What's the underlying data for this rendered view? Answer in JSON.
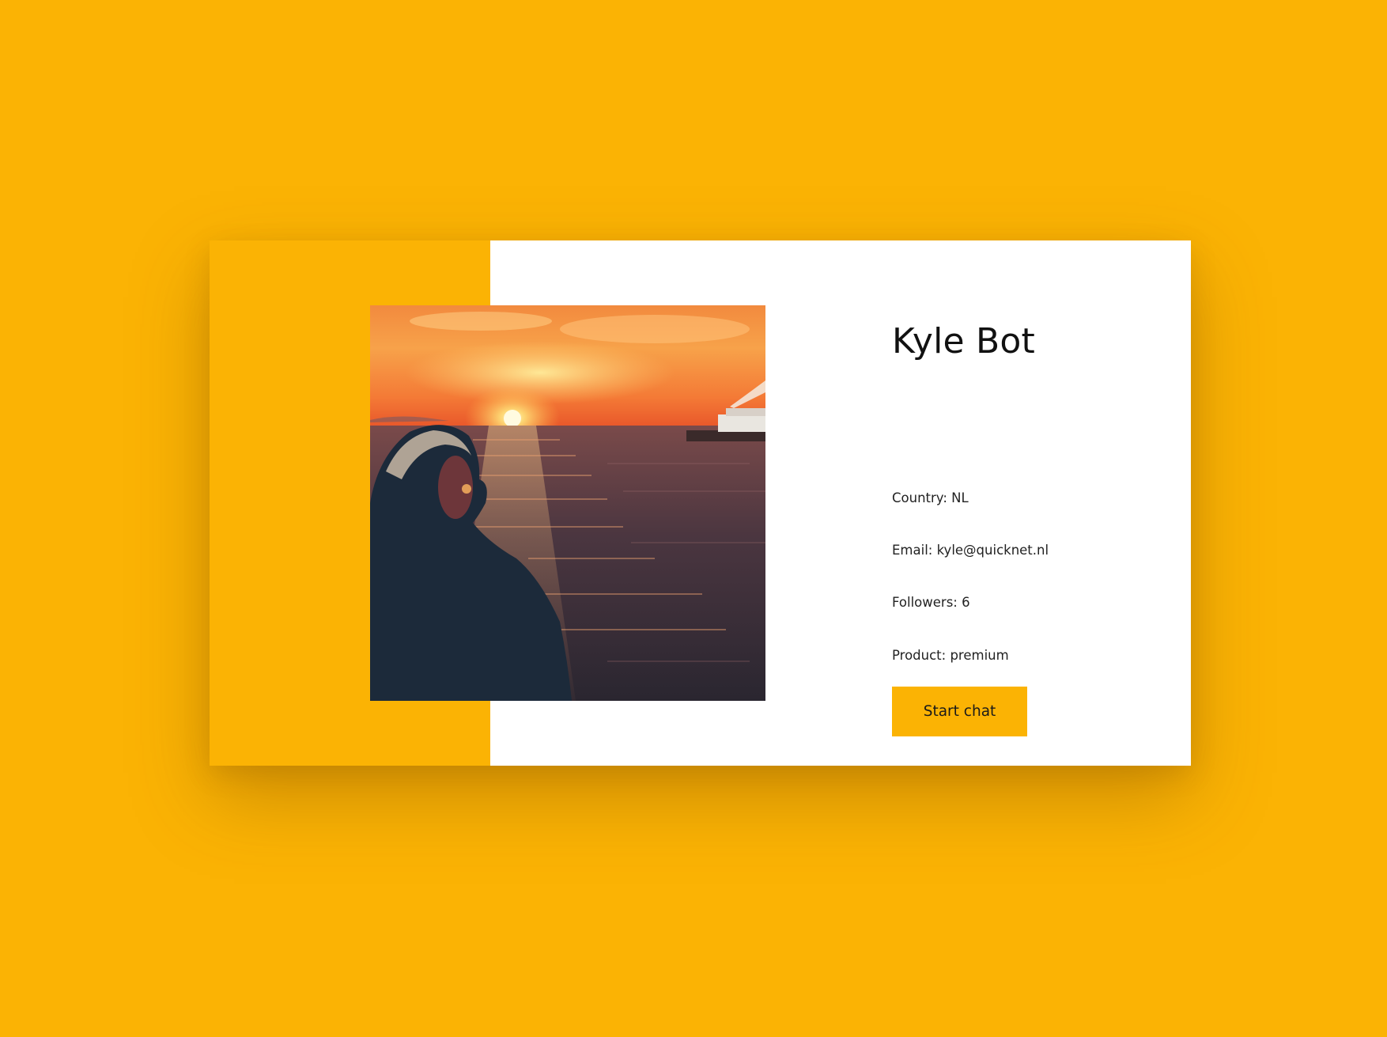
{
  "profile": {
    "name": "Kyle Bot",
    "details": {
      "country": "Country: NL",
      "email": "Email: kyle@quicknet.nl",
      "followers": "Followers: 6",
      "product": "Product: premium"
    },
    "start_chat_label": "Start chat",
    "photo_alt": "Kyle Bot"
  },
  "colors": {
    "background": "#FBB304",
    "card": "#FFFFFF",
    "accent": "#FBB304",
    "button": "#FBB304",
    "text": "#111111"
  }
}
